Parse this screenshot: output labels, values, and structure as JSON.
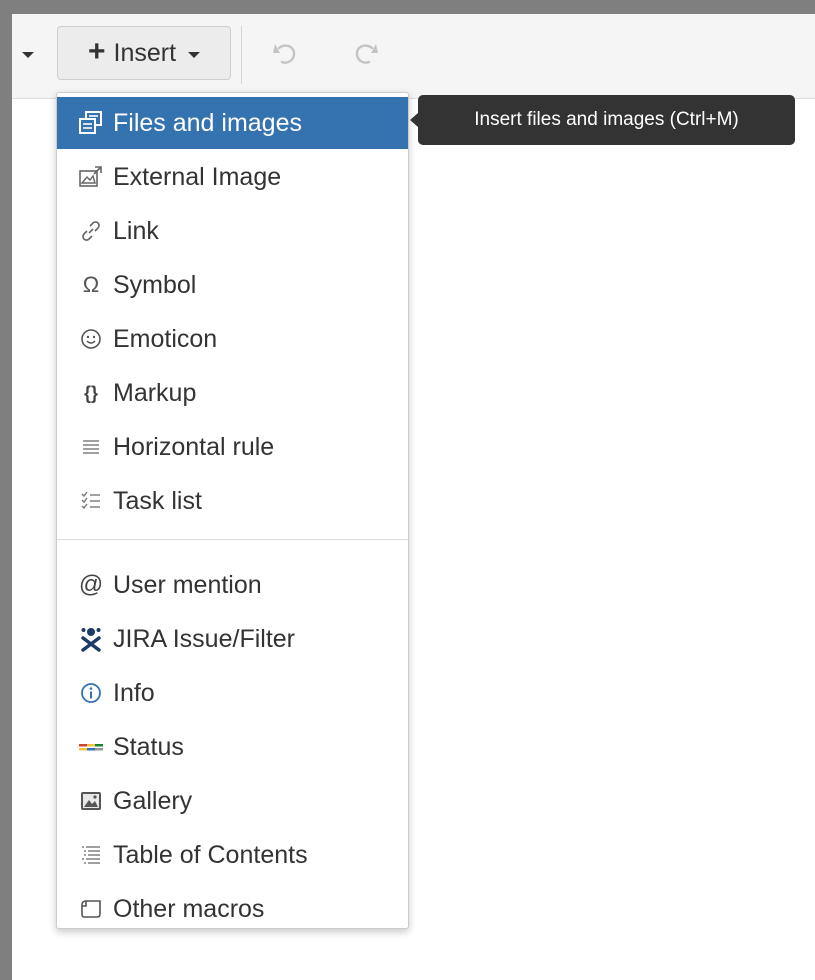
{
  "toolbar": {
    "insert_label": "Insert",
    "plus_glyph": "+",
    "undo_icon": "undo-icon",
    "redo_icon": "redo-icon"
  },
  "insert_menu": {
    "items": [
      {
        "label": "Files and images",
        "icon": "files-images-icon",
        "active": true
      },
      {
        "label": "External Image",
        "icon": "external-image-icon"
      },
      {
        "label": "Link",
        "icon": "link-icon"
      },
      {
        "label": "Symbol",
        "icon": "omega-icon"
      },
      {
        "label": "Emoticon",
        "icon": "smiley-icon"
      },
      {
        "label": "Markup",
        "icon": "braces-icon"
      },
      {
        "label": "Horizontal rule",
        "icon": "horizontal-rule-icon"
      },
      {
        "label": "Task list",
        "icon": "task-list-icon"
      },
      {
        "label": "User mention",
        "icon": "at-icon"
      },
      {
        "label": "JIRA Issue/Filter",
        "icon": "jira-icon"
      },
      {
        "label": "Info",
        "icon": "info-icon"
      },
      {
        "label": "Status",
        "icon": "status-icon"
      },
      {
        "label": "Gallery",
        "icon": "gallery-icon"
      },
      {
        "label": "Table of Contents",
        "icon": "toc-icon"
      },
      {
        "label": "Other macros",
        "icon": "macro-icon"
      }
    ]
  },
  "tooltip": {
    "text": "Insert files and images (Ctrl+M)"
  },
  "colors": {
    "active_bg": "#3572b0",
    "tooltip_bg": "#333333",
    "frame_border": "#7f7f7f"
  }
}
